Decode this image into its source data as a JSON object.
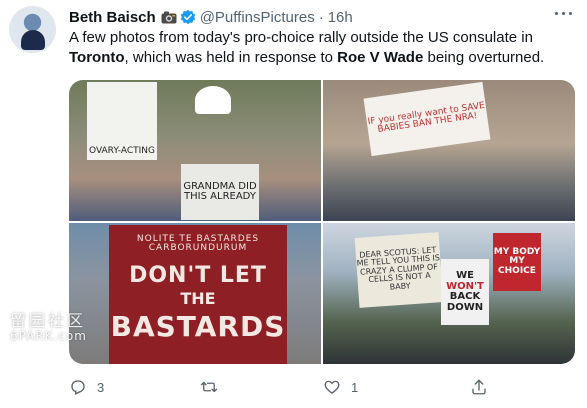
{
  "author": {
    "display_name": "Beth Baisch",
    "handle": "@PuffinsPictures",
    "separator": "·",
    "time": "16h",
    "badges": [
      "camera-icon",
      "verified-icon"
    ]
  },
  "tweet": {
    "line1": "A few photos from today's pro-choice rally outside the US consulate in",
    "line2_bold1": "Toronto",
    "line2_mid": ", which was held in response to ",
    "line2_bold2": "Roe V Wade",
    "line2_end": " being overturned."
  },
  "photos": {
    "ovary_sign": "OVARY-ACTING",
    "grandma_sign": "GRANDMA DID THIS ALREADY",
    "save_babies_sign": "IF you really want to SAVE BABIES BAN THE NRA!",
    "nolite_small": "NOLITE TE BASTARDES CARBORUNDURUM",
    "nolite_line1": "DON'T LET",
    "nolite_line2": "THE",
    "nolite_line3": "BASTARDS",
    "scotus_sign": "DEAR SCOTUS: LET ME TELL YOU THIS IS CRAZY A CLUMP OF CELLS IS NOT A BABY",
    "we_wont_1": "WE",
    "we_wont_2": "WON'T",
    "we_wont_3": "BACK DOWN",
    "my_body_sign": "MY BODY MY CHOICE"
  },
  "watermark": {
    "line1": "留园社区",
    "line2": "6PARK.com"
  },
  "actions": {
    "reply_count": "3",
    "retweet_count": "",
    "like_count": "1"
  },
  "colors": {
    "verified": "#1d9bf0",
    "muted": "#536471",
    "text": "#0f1419"
  }
}
